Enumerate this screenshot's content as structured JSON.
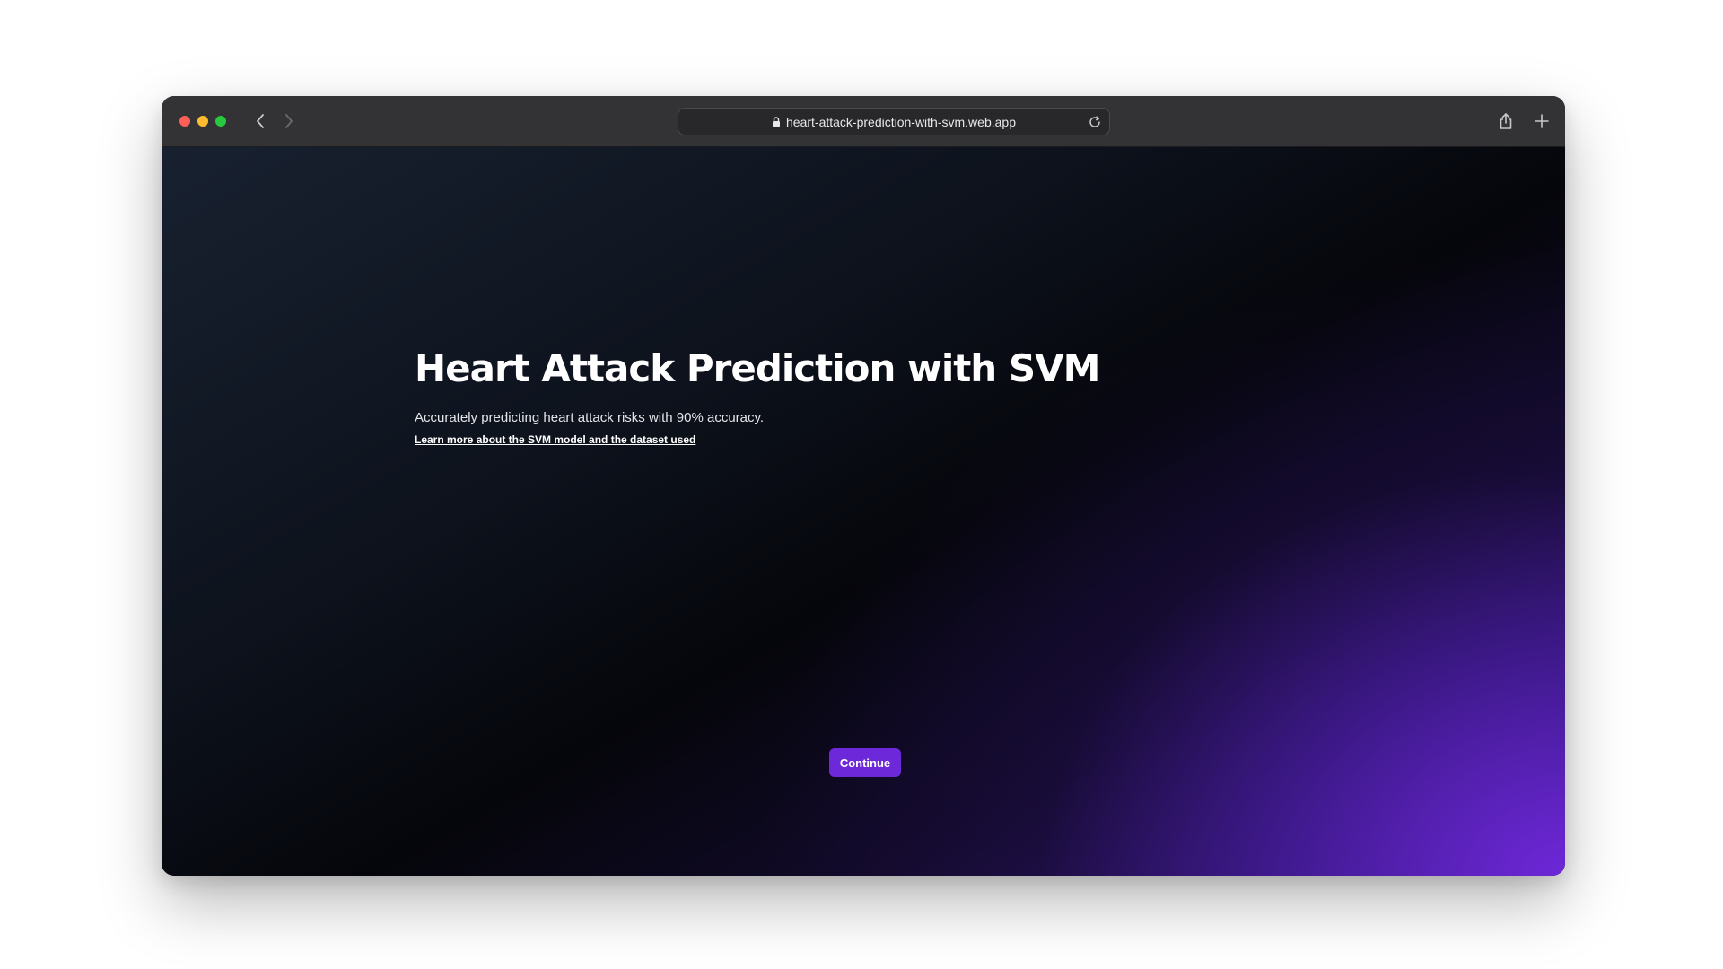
{
  "browser": {
    "url": "heart-attack-prediction-with-svm.web.app",
    "traffic_lights": {
      "close": "#ff5f57",
      "minimize": "#febc2e",
      "zoom": "#28c840"
    }
  },
  "page": {
    "title": "Heart Attack Prediction with SVM",
    "subtitle": "Accurately predicting heart attack risks with 90% accuracy.",
    "learn_more_link": "Learn more about the SVM model and the dataset used",
    "continue_label": "Continue"
  },
  "colors": {
    "accent": "#6d28d9",
    "background_dark": "#05060b",
    "gradient_purple": "#7028dc"
  },
  "icons": {
    "back": "chevron-left-icon",
    "forward": "chevron-right-icon",
    "lock": "lock-icon",
    "reload": "reload-icon",
    "share": "share-icon",
    "new_tab": "plus-icon"
  }
}
